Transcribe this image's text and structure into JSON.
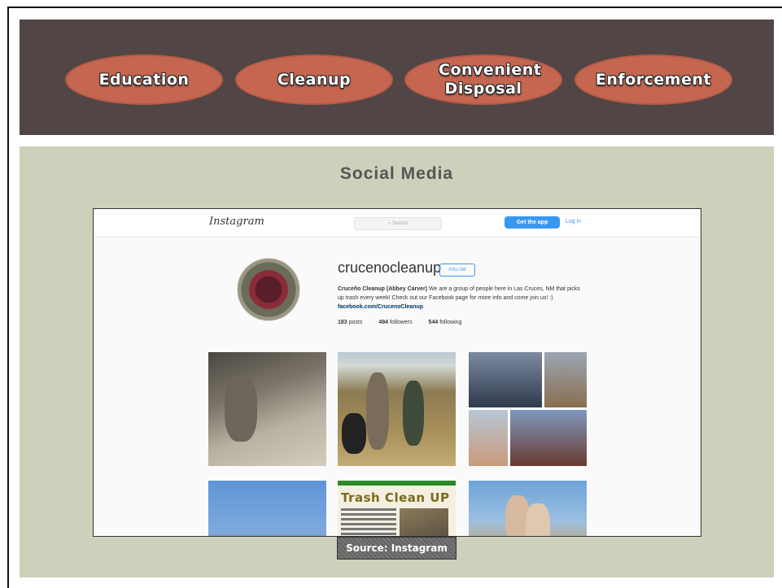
{
  "banner": {
    "pills": [
      "Education",
      "Cleanup",
      "Convenient Disposal",
      "Enforcement"
    ]
  },
  "section": {
    "title": "Social Media"
  },
  "instagram": {
    "logo": "Instagram",
    "search_placeholder": "Search",
    "get_app": "Get the app",
    "login": "Log in",
    "username": "crucenocleanup",
    "follow": "FOLLOW",
    "bio_name": "Cruceño Cleanup (Abbey Carver)",
    "bio_text": " We are a group of people here in Las Cruces, NM that picks up trash every week! Check out our Facebook page for more info and come join us! :) ",
    "bio_link": "facebook.com/CrucenoCleanup",
    "posts_count": "183",
    "posts_label": "posts",
    "followers_count": "494",
    "followers_label": "followers",
    "following_count": "544",
    "following_label": "following",
    "post_trash_title": "Trash Clean UP"
  },
  "caption": "Source: Instagram",
  "colors": {
    "banner_bg": "#514545",
    "pill_fill": "#c56650",
    "section_bg": "#cdd1bb",
    "ig_blue": "#3897f0"
  }
}
